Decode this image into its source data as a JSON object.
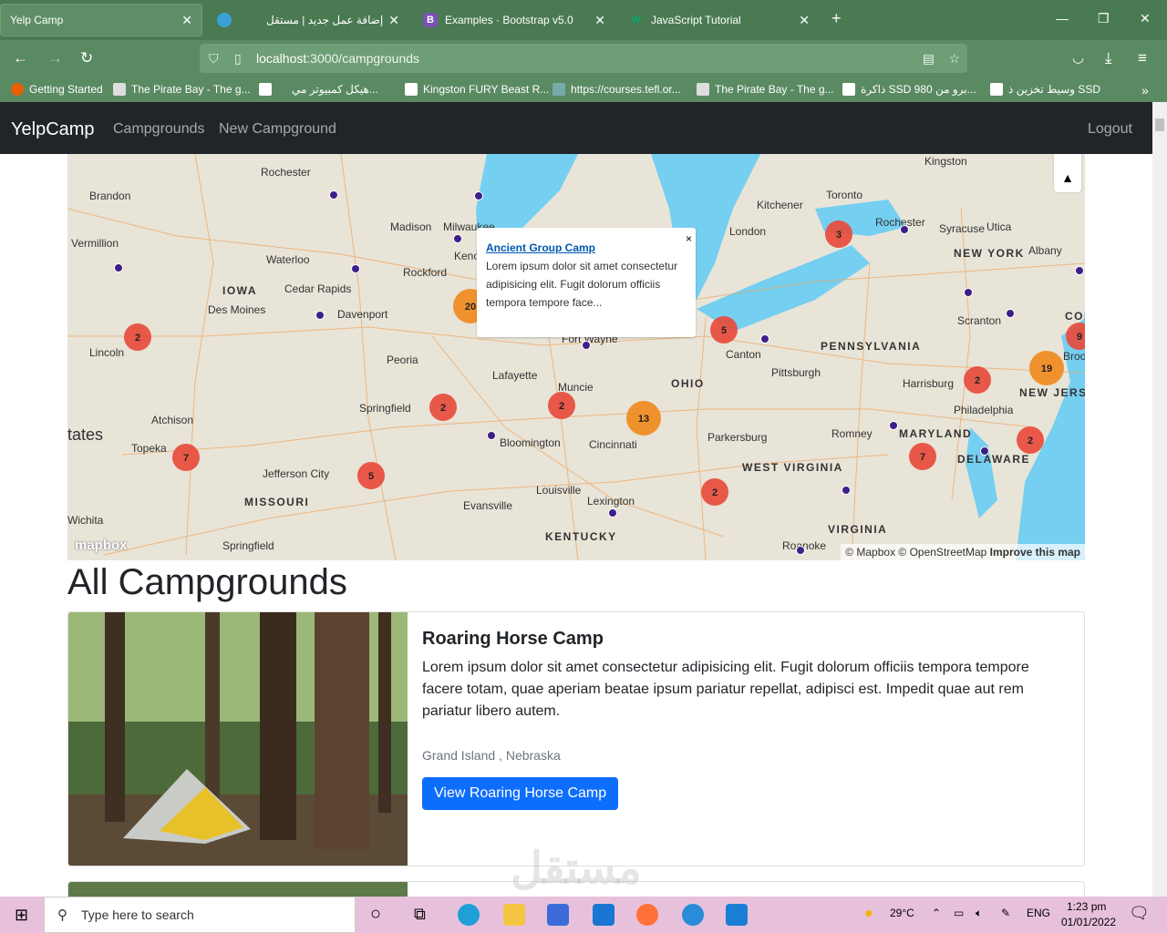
{
  "browser": {
    "tabs": [
      {
        "title": "Yelp Camp",
        "active": true
      },
      {
        "title": "إضافة عمل جديد | مستقل",
        "active": false
      },
      {
        "title": "Examples · Bootstrap v5.0",
        "active": false
      },
      {
        "title": "JavaScript Tutorial",
        "active": false
      }
    ],
    "url_host": "localhost",
    "url_path": ":3000/campgrounds",
    "bookmarks": [
      "Getting Started",
      "The Pirate Bay - The g...",
      "هيكل كمبيوتر مي...",
      "Kingston FURY Beast R...",
      "https://courses.tefl.or...",
      "The Pirate Bay - The g...",
      "ذاكرة SSD 980 برو من...",
      "وسيط تخزين ذ SSD"
    ]
  },
  "nav": {
    "brand": "YelpCamp",
    "links": [
      "Campgrounds",
      "New Campground"
    ],
    "logout": "Logout"
  },
  "map": {
    "popup_title": "Ancient Group Camp",
    "popup_text": "Lorem ipsum dolor sit amet consectetur adipisicing elit. Fugit dolorum officiis tempora tempore face...",
    "popup_close": "×",
    "attribution": "© Mapbox © OpenStreetMap",
    "improve": "Improve this map",
    "logo": "mapbox",
    "clusters": [
      "3",
      "20",
      "5",
      "9",
      "2",
      "19",
      "2",
      "2",
      "2",
      "13",
      "7",
      "5",
      "2",
      "7",
      "2"
    ],
    "places": [
      "Rochester",
      "Brandon",
      "Madison",
      "Milwaukee",
      "Vermillion",
      "Waterloo",
      "Rockford",
      "IOWA",
      "Cedar Rapids",
      "Des Moines",
      "Davenport",
      "Lincoln",
      "Peoria",
      "Lafayette",
      "Muncie",
      "Springfield",
      "Atchison",
      "Topeka",
      "Bloomington",
      "Cincinnati",
      "Jefferson City",
      "MISSOURI",
      "Louisville",
      "Evansville",
      "Lexington",
      "KENTUCKY",
      "Wichita",
      "Springfield",
      "Kingston",
      "Toronto",
      "Kitchener",
      "London",
      "Rochester",
      "Syracuse",
      "Utica",
      "NEW YORK",
      "Albany",
      "Scranton",
      "PENNSYLVANIA",
      "Canton",
      "Pittsburgh",
      "OHIO",
      "Harrisburg",
      "Philadelphia",
      "NEW JERSEY",
      "Parkersburg",
      "Romney",
      "MARYLAND",
      "DELAWARE",
      "WEST VIRGINIA",
      "VIRGINIA",
      "Roanoke",
      "Fort Wayne",
      "tates",
      "Kenosha",
      "Brook",
      "CON"
    ]
  },
  "page": {
    "heading": "All Campgrounds"
  },
  "campground": {
    "title": "Roaring Horse Camp",
    "description": "Lorem ipsum dolor sit amet consectetur adipisicing elit. Fugit dolorum officiis tempora tempore facere totam, quae aperiam beatae ipsum pariatur repellat, adipisci est. Impedit quae aut rem pariatur libero autem.",
    "location": "Grand Island , Nebraska",
    "button": "View Roaring Horse Camp"
  },
  "taskbar": {
    "search_placeholder": "Type here to search",
    "weather": "29°C",
    "lang": "ENG",
    "time": "1:23 pm",
    "date": "01/01/2022"
  },
  "watermark": "مستقل"
}
